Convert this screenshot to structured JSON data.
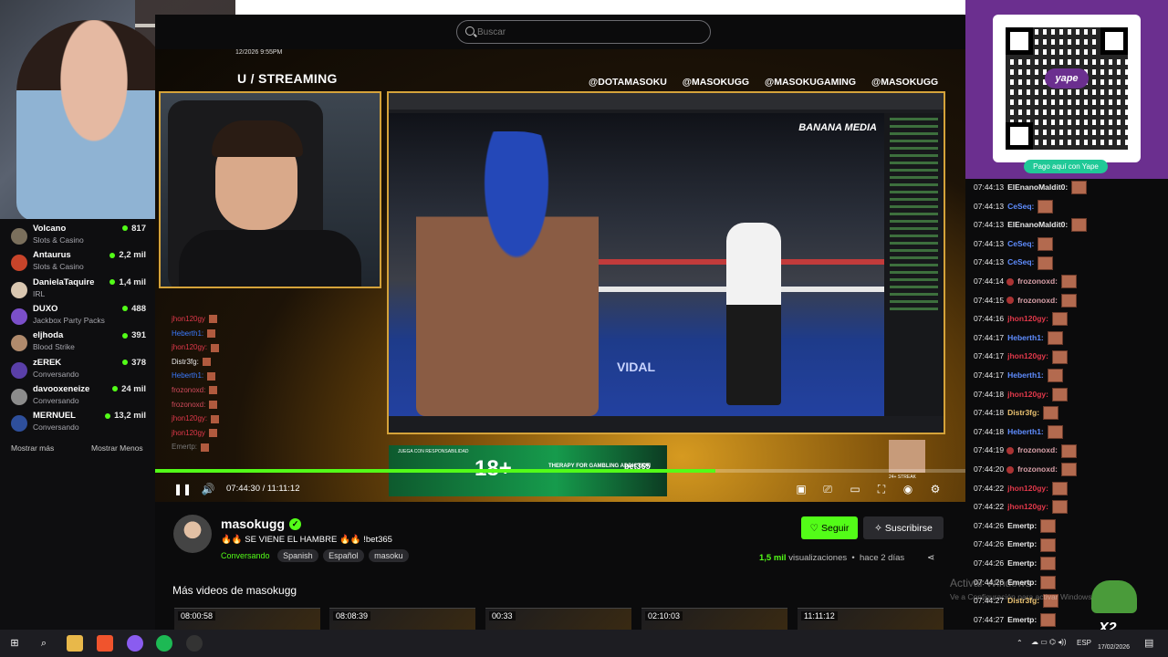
{
  "search": {
    "placeholder": "Buscar"
  },
  "sidebar": {
    "channels": [
      {
        "name": "Volcano",
        "category": "Slots & Casino",
        "viewers": "817",
        "color": "#7a6f5c"
      },
      {
        "name": "Antaurus",
        "category": "Slots & Casino",
        "viewers": "2,2 mil",
        "color": "#c8442a"
      },
      {
        "name": "DanielaTaquire",
        "category": "IRL",
        "viewers": "1,4 mil",
        "color": "#d9c6b0"
      },
      {
        "name": "DUXO",
        "category": "Jackbox Party Packs",
        "viewers": "488",
        "color": "#7b4fc9"
      },
      {
        "name": "eljhoda",
        "category": "Blood Strike",
        "viewers": "391",
        "color": "#b08a6c"
      },
      {
        "name": "zEREK",
        "category": "Conversando",
        "viewers": "378",
        "color": "#5a3fa8"
      },
      {
        "name": "davooxeneize",
        "category": "Conversando",
        "viewers": "24 mil",
        "color": "#8c8c8c"
      },
      {
        "name": "MERNUEL",
        "category": "Conversando",
        "viewers": "13,2 mil",
        "color": "#2e4f9c"
      }
    ],
    "show_more": "Mostrar más",
    "show_less": "Mostrar Menos"
  },
  "overlay": {
    "timestamp": "12/2026 9:55PM",
    "title": "U / STREAMING",
    "socials": [
      "@DOTAMASOKU",
      "@MASOKUGG",
      "@MASOKUGAMING",
      "@MASOKUGG"
    ],
    "chat": [
      {
        "user": "jhon120gy",
        "color": "#e0384a"
      },
      {
        "user": "Heberth1:",
        "color": "#3b7bff"
      },
      {
        "user": "jhon120gy:",
        "color": "#e0384a"
      },
      {
        "user": "Distr3fg:",
        "color": "#e8e8e8"
      },
      {
        "user": "Heberth1:",
        "color": "#3b7bff"
      },
      {
        "user": "frozonoxd:",
        "color": "#d04a5a"
      },
      {
        "user": "frozonoxd:",
        "color": "#d04a5a"
      },
      {
        "user": "jhon120gy:",
        "color": "#e0384a"
      },
      {
        "user": "jhon120gy",
        "color": "#e0384a"
      },
      {
        "user": "Emertp:",
        "color": "#777"
      }
    ],
    "screen_brand": "BANANA MEDIA",
    "ring_text": "VIDAL",
    "ad": {
      "small": "JUEGA CON RESPONSABILIDAD",
      "big": "18+",
      "mid": "THERAPY FOR GAMBLING ADDICTION",
      "brand": "bet365"
    },
    "streak": "24+ STREAK"
  },
  "player": {
    "current_time": "07:44:30",
    "separator": "/",
    "duration": "11:11:12",
    "progress": 0.692
  },
  "channel": {
    "name": "masokugg",
    "title": "🔥🔥 SE VIENE EL HAMBRE 🔥🔥  !bet365",
    "category": "Conversando",
    "tags": [
      "Spanish",
      "Español",
      "masoku"
    ],
    "follow": "Seguir",
    "subscribe": "Suscribirse",
    "views_num": "1,5 mil",
    "views_label": "visualizaciones",
    "ago": "hace 2 días"
  },
  "more_videos": {
    "title": "Más videos de masokugg",
    "durations": [
      "08:00:58",
      "08:08:39",
      "00:33",
      "02:10:03",
      "11:11:12"
    ]
  },
  "yape": {
    "badge": "yape",
    "pill": "Pago aquí con Yape"
  },
  "chat": [
    {
      "time": "07:44:13",
      "user": "ElEnanoMaldit0:",
      "color": "#e8e8e8"
    },
    {
      "time": "07:44:13",
      "user": "CeSeq:",
      "color": "#5f8dff"
    },
    {
      "time": "07:44:13",
      "user": "ElEnanoMaldit0:",
      "color": "#e8e8e8"
    },
    {
      "time": "07:44:13",
      "user": "CeSeq:",
      "color": "#5f8dff"
    },
    {
      "time": "07:44:13",
      "user": "CeSeq:",
      "color": "#5f8dff"
    },
    {
      "time": "07:44:14",
      "user": "frozonoxd:",
      "color": "#d8a0a8",
      "badge": true
    },
    {
      "time": "07:44:15",
      "user": "frozonoxd:",
      "color": "#d8a0a8",
      "badge": true
    },
    {
      "time": "07:44:16",
      "user": "jhon120gy:",
      "color": "#e0384a"
    },
    {
      "time": "07:44:17",
      "user": "Heberth1:",
      "color": "#5f8dff"
    },
    {
      "time": "07:44:17",
      "user": "jhon120gy:",
      "color": "#e0384a"
    },
    {
      "time": "07:44:17",
      "user": "Heberth1:",
      "color": "#5f8dff"
    },
    {
      "time": "07:44:18",
      "user": "jhon120gy:",
      "color": "#e0384a"
    },
    {
      "time": "07:44:18",
      "user": "Distr3fg:",
      "color": "#e8c070"
    },
    {
      "time": "07:44:18",
      "user": "Heberth1:",
      "color": "#5f8dff"
    },
    {
      "time": "07:44:19",
      "user": "frozonoxd:",
      "color": "#d8a0a8",
      "badge": true
    },
    {
      "time": "07:44:20",
      "user": "frozonoxd:",
      "color": "#d8a0a8",
      "badge": true
    },
    {
      "time": "07:44:22",
      "user": "jhon120gy:",
      "color": "#e0384a"
    },
    {
      "time": "07:44:22",
      "user": "jhon120gy:",
      "color": "#e0384a"
    },
    {
      "time": "07:44:26",
      "user": "Emertp:",
      "color": "#e8e8e8"
    },
    {
      "time": "07:44:26",
      "user": "Emertp:",
      "color": "#e8e8e8"
    },
    {
      "time": "07:44:26",
      "user": "Emertp:",
      "color": "#e8e8e8"
    },
    {
      "time": "07:44:26",
      "user": "Emertp:",
      "color": "#e8e8e8"
    },
    {
      "time": "07:44:27",
      "user": "Distr3fg:",
      "color": "#e8c070"
    },
    {
      "time": "07:44:27",
      "user": "Emertp:",
      "color": "#e8e8e8"
    },
    {
      "time": "07:44:27",
      "user": "Emertp:",
      "color": "#e8e8e8"
    }
  ],
  "windows": {
    "activate_title": "Activar Windows",
    "activate_sub": "Ve a Configuración para activar Windows."
  },
  "pepe_badge": "X2",
  "taskbar": {
    "lang": "ESP",
    "date": "17/02/2026",
    "icons": [
      "windows-start-icon",
      "search-icon",
      "file-explorer-icon",
      "brave-browser-icon",
      "messenger-icon",
      "spotify-icon",
      "obs-icon"
    ]
  },
  "colors": {
    "accent": "#53fc18",
    "yape": "#6b2f8f",
    "bg": "#0b0b0c"
  }
}
